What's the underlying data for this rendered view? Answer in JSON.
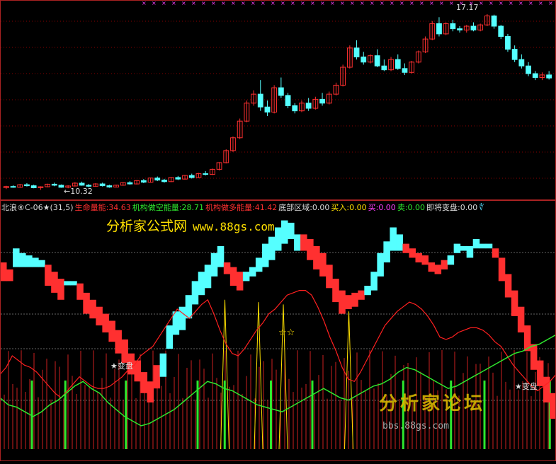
{
  "indicator_bar": {
    "name": "北浪®C-06★(31,5)",
    "life": "生命量能:34.63",
    "short": "机构做空能量:28.71",
    "long": "机构做多能量:41.42",
    "bottom": "底部区域:0.00",
    "buy": "买入:0.00",
    "buy2": "买:0.00",
    "sell": "卖:0.00",
    "change": "即将变盘:0.00",
    "tail": "∜"
  },
  "labels": {
    "low_price": "←10.32",
    "high_price": "17.17",
    "change_mid": "★变盘",
    "change_right": "★变盘",
    "stars": "☆☆"
  },
  "watermarks": {
    "top_cn": "分析家公式网",
    "top_url": "www.88gs.com",
    "bottom_cn": "分析家论坛",
    "bottom_url": "bbs.88gs.com"
  },
  "colors": {
    "up": "#ff3030",
    "down": "#55ffff",
    "life_line": "#ff2020",
    "green_line": "#2ee82e",
    "grid": "#880000"
  },
  "chart_data": [
    {
      "type": "candlestick",
      "y_markers": {
        "low": 10.32,
        "high": 17.17
      },
      "ohlc": [
        [
          10.4,
          10.48,
          10.35,
          10.45
        ],
        [
          10.45,
          10.5,
          10.4,
          10.42
        ],
        [
          10.42,
          10.55,
          10.4,
          10.52
        ],
        [
          10.52,
          10.58,
          10.45,
          10.48
        ],
        [
          10.48,
          10.52,
          10.38,
          10.4
        ],
        [
          10.4,
          10.46,
          10.32,
          10.44
        ],
        [
          10.44,
          10.56,
          10.42,
          10.54
        ],
        [
          10.54,
          10.6,
          10.46,
          10.5
        ],
        [
          10.5,
          10.53,
          10.4,
          10.42
        ],
        [
          10.42,
          10.5,
          10.38,
          10.47
        ],
        [
          10.47,
          10.62,
          10.45,
          10.58
        ],
        [
          10.58,
          10.64,
          10.48,
          10.5
        ],
        [
          10.5,
          10.55,
          10.42,
          10.46
        ],
        [
          10.46,
          10.58,
          10.44,
          10.55
        ],
        [
          10.55,
          10.6,
          10.45,
          10.48
        ],
        [
          10.48,
          10.52,
          10.4,
          10.43
        ],
        [
          10.43,
          10.52,
          10.41,
          10.5
        ],
        [
          10.5,
          10.62,
          10.48,
          10.6
        ],
        [
          10.6,
          10.66,
          10.52,
          10.55
        ],
        [
          10.55,
          10.7,
          10.53,
          10.68
        ],
        [
          10.68,
          10.74,
          10.58,
          10.62
        ],
        [
          10.62,
          10.8,
          10.6,
          10.78
        ],
        [
          10.78,
          10.84,
          10.66,
          10.7
        ],
        [
          10.7,
          10.75,
          10.6,
          10.64
        ],
        [
          10.64,
          10.82,
          10.62,
          10.8
        ],
        [
          10.8,
          10.86,
          10.7,
          10.74
        ],
        [
          10.74,
          10.9,
          10.72,
          10.88
        ],
        [
          10.88,
          10.95,
          10.76,
          10.8
        ],
        [
          10.8,
          10.98,
          10.78,
          10.95
        ],
        [
          10.95,
          11.05,
          10.88,
          10.92
        ],
        [
          10.92,
          11.15,
          10.9,
          11.12
        ],
        [
          11.12,
          11.4,
          11.08,
          11.38
        ],
        [
          11.38,
          11.9,
          11.35,
          11.85
        ],
        [
          11.85,
          12.4,
          11.8,
          12.35
        ],
        [
          12.35,
          13.1,
          12.3,
          13.0
        ],
        [
          13.0,
          13.8,
          12.95,
          13.7
        ],
        [
          13.7,
          14.2,
          13.6,
          14.05
        ],
        [
          14.05,
          14.6,
          13.4,
          13.55
        ],
        [
          13.55,
          13.8,
          13.2,
          13.35
        ],
        [
          13.35,
          14.4,
          13.3,
          14.3
        ],
        [
          14.3,
          14.7,
          13.9,
          14.0
        ],
        [
          14.0,
          14.1,
          13.5,
          13.6
        ],
        [
          13.6,
          13.7,
          13.3,
          13.4
        ],
        [
          13.4,
          13.8,
          13.35,
          13.7
        ],
        [
          13.7,
          13.9,
          13.4,
          13.5
        ],
        [
          13.5,
          13.95,
          13.45,
          13.85
        ],
        [
          13.85,
          14.1,
          13.6,
          13.7
        ],
        [
          13.7,
          14.15,
          13.65,
          14.05
        ],
        [
          14.05,
          14.5,
          14.0,
          14.4
        ],
        [
          14.4,
          15.2,
          14.35,
          15.1
        ],
        [
          15.1,
          15.95,
          15.05,
          15.85
        ],
        [
          15.85,
          16.15,
          15.4,
          15.5
        ],
        [
          15.5,
          15.7,
          15.2,
          15.3
        ],
        [
          15.3,
          15.6,
          15.25,
          15.55
        ],
        [
          15.55,
          15.8,
          15.1,
          15.15
        ],
        [
          15.15,
          15.4,
          14.95,
          15.0
        ],
        [
          15.0,
          15.5,
          14.95,
          15.4
        ],
        [
          15.4,
          15.6,
          15.0,
          15.05
        ],
        [
          15.05,
          15.25,
          14.8,
          14.9
        ],
        [
          14.9,
          15.35,
          14.85,
          15.3
        ],
        [
          15.3,
          15.75,
          15.25,
          15.7
        ],
        [
          15.7,
          16.3,
          15.65,
          16.2
        ],
        [
          16.2,
          16.9,
          16.15,
          16.8
        ],
        [
          16.8,
          17.05,
          16.3,
          16.4
        ],
        [
          16.4,
          16.85,
          16.35,
          16.8
        ],
        [
          16.8,
          16.95,
          16.5,
          16.6
        ],
        [
          16.6,
          16.7,
          16.45,
          16.55
        ],
        [
          16.55,
          16.75,
          16.45,
          16.7
        ],
        [
          16.7,
          16.85,
          16.5,
          16.55
        ],
        [
          16.55,
          16.8,
          16.5,
          16.75
        ],
        [
          16.75,
          17.17,
          16.7,
          17.1
        ],
        [
          17.1,
          17.15,
          16.6,
          16.7
        ],
        [
          16.7,
          16.75,
          16.2,
          16.3
        ],
        [
          16.3,
          16.4,
          15.7,
          15.8
        ],
        [
          15.8,
          15.95,
          15.3,
          15.4
        ],
        [
          15.4,
          15.6,
          15.05,
          15.15
        ],
        [
          15.15,
          15.3,
          14.75,
          14.85
        ],
        [
          14.85,
          14.95,
          14.6,
          14.7
        ],
        [
          14.7,
          14.9,
          14.6,
          14.8
        ],
        [
          14.8,
          14.95,
          14.62,
          14.68
        ]
      ]
    },
    {
      "type": "indicator",
      "ylim": [
        0,
        100
      ],
      "blocks": [
        [
          80,
          72,
          "up"
        ],
        [
          77,
          72,
          "up"
        ],
        [
          86,
          78,
          "down"
        ],
        [
          84,
          78,
          "down"
        ],
        [
          83,
          78,
          "down"
        ],
        [
          82,
          78,
          "down"
        ],
        [
          81,
          78,
          "down"
        ],
        [
          79,
          70,
          "up"
        ],
        [
          76,
          67,
          "up"
        ],
        [
          73,
          64,
          "up"
        ],
        [
          72,
          72,
          "down"
        ],
        [
          72,
          72,
          "down"
        ],
        [
          71,
          64,
          "up"
        ],
        [
          67,
          58,
          "up"
        ],
        [
          64,
          56,
          "up"
        ],
        [
          61,
          53,
          "up"
        ],
        [
          58,
          50,
          "up"
        ],
        [
          55,
          46,
          "up"
        ],
        [
          51,
          41,
          "up"
        ],
        [
          47,
          37,
          "up"
        ],
        [
          41,
          32,
          "up"
        ],
        [
          38,
          29,
          "up"
        ],
        [
          33,
          24,
          "up"
        ],
        [
          29,
          20,
          "up"
        ],
        [
          36,
          26,
          "up"
        ],
        [
          41,
          31,
          "down"
        ],
        [
          53,
          43,
          "down"
        ],
        [
          59,
          49,
          "down"
        ],
        [
          61,
          51,
          "down"
        ],
        [
          66,
          56,
          "down"
        ],
        [
          72,
          62,
          "down"
        ],
        [
          76,
          66,
          "down"
        ],
        [
          79,
          69,
          "down"
        ],
        [
          84,
          74,
          "down"
        ],
        [
          87,
          78,
          "down"
        ],
        [
          80,
          75,
          "up"
        ],
        [
          78,
          70,
          "up"
        ],
        [
          76,
          68,
          "up"
        ],
        [
          76,
          72,
          "down"
        ],
        [
          78,
          74,
          "down"
        ],
        [
          82,
          76,
          "down"
        ],
        [
          88,
          78,
          "down"
        ],
        [
          91,
          81,
          "down"
        ],
        [
          95,
          85,
          "down"
        ],
        [
          98,
          88,
          "down"
        ],
        [
          97,
          90,
          "down"
        ],
        [
          92,
          85,
          "down"
        ],
        [
          92,
          85,
          "up"
        ],
        [
          90,
          81,
          "up"
        ],
        [
          87,
          77,
          "up"
        ],
        [
          84,
          74,
          "up"
        ],
        [
          79,
          69,
          "up"
        ],
        [
          73,
          63,
          "up"
        ],
        [
          68,
          58,
          "up"
        ],
        [
          66,
          60,
          "up"
        ],
        [
          67,
          61,
          "up"
        ],
        [
          68,
          64,
          "up"
        ],
        [
          70,
          66,
          "down"
        ],
        [
          76,
          68,
          "down"
        ],
        [
          84,
          74,
          "down"
        ],
        [
          89,
          80,
          "down"
        ],
        [
          95,
          85,
          "down"
        ],
        [
          92,
          85,
          "down"
        ],
        [
          88,
          84,
          "up"
        ],
        [
          86,
          82,
          "up"
        ],
        [
          84,
          80,
          "up"
        ],
        [
          83,
          79,
          "up"
        ],
        [
          80,
          76,
          "up"
        ],
        [
          79,
          75,
          "up"
        ],
        [
          81,
          77,
          "up"
        ],
        [
          83,
          79,
          "down"
        ],
        [
          88,
          84,
          "down"
        ],
        [
          87,
          85,
          "down"
        ],
        [
          87,
          82,
          "down"
        ],
        [
          90,
          86,
          "down"
        ],
        [
          88,
          86,
          "down"
        ],
        [
          88,
          86,
          "down"
        ],
        [
          86,
          82,
          "up"
        ],
        [
          82,
          72,
          "up"
        ],
        [
          75,
          65,
          "up"
        ],
        [
          68,
          57,
          "up"
        ],
        [
          61,
          50,
          "up"
        ],
        [
          53,
          42,
          "up"
        ],
        [
          45,
          34,
          "up"
        ],
        [
          38,
          27,
          "up"
        ],
        [
          31,
          20,
          "up"
        ],
        [
          24,
          13,
          "up"
        ]
      ],
      "life_line": [
        32,
        35,
        40,
        38,
        36,
        35,
        33,
        30,
        27,
        24,
        22,
        25,
        28,
        31,
        29,
        27,
        26,
        26,
        27,
        29,
        31,
        34,
        36,
        40,
        42,
        44,
        48,
        52,
        56,
        60,
        58,
        56,
        59,
        62,
        64,
        58,
        51,
        45,
        41,
        40,
        43,
        47,
        51,
        54,
        58,
        60,
        63,
        66,
        67,
        68,
        68,
        66,
        61,
        55,
        48,
        42,
        35,
        30,
        29,
        33,
        38,
        43,
        48,
        53,
        56,
        59,
        61,
        63,
        62,
        60,
        57,
        53,
        48,
        47,
        48,
        50,
        51,
        52,
        52,
        51,
        49,
        46,
        44,
        40,
        36,
        33,
        30,
        27,
        25,
        27,
        29,
        32
      ],
      "green_line": [
        22,
        19,
        18,
        16,
        14,
        16,
        19,
        21,
        24,
        27,
        29,
        26,
        24,
        20,
        17,
        14,
        12,
        10,
        11,
        13,
        15,
        17,
        20,
        23,
        26,
        29,
        28,
        26,
        25,
        23,
        21,
        19,
        18,
        17,
        16,
        18,
        20,
        22,
        24,
        26,
        24,
        22,
        21,
        23,
        25,
        27,
        28,
        30,
        33,
        35,
        34,
        32,
        30,
        28,
        26,
        27,
        29,
        31,
        33,
        35,
        37,
        39,
        41,
        42,
        44,
        45,
        47,
        49
      ],
      "green_bars": [
        20,
        41,
        79,
        124,
        141,
        170,
        196,
        253,
        283,
        304,
        345
      ],
      "spikes": [
        [
          127,
          24
        ],
        [
          146,
          23
        ],
        [
          160,
          22
        ],
        [
          197,
          19
        ]
      ]
    }
  ]
}
